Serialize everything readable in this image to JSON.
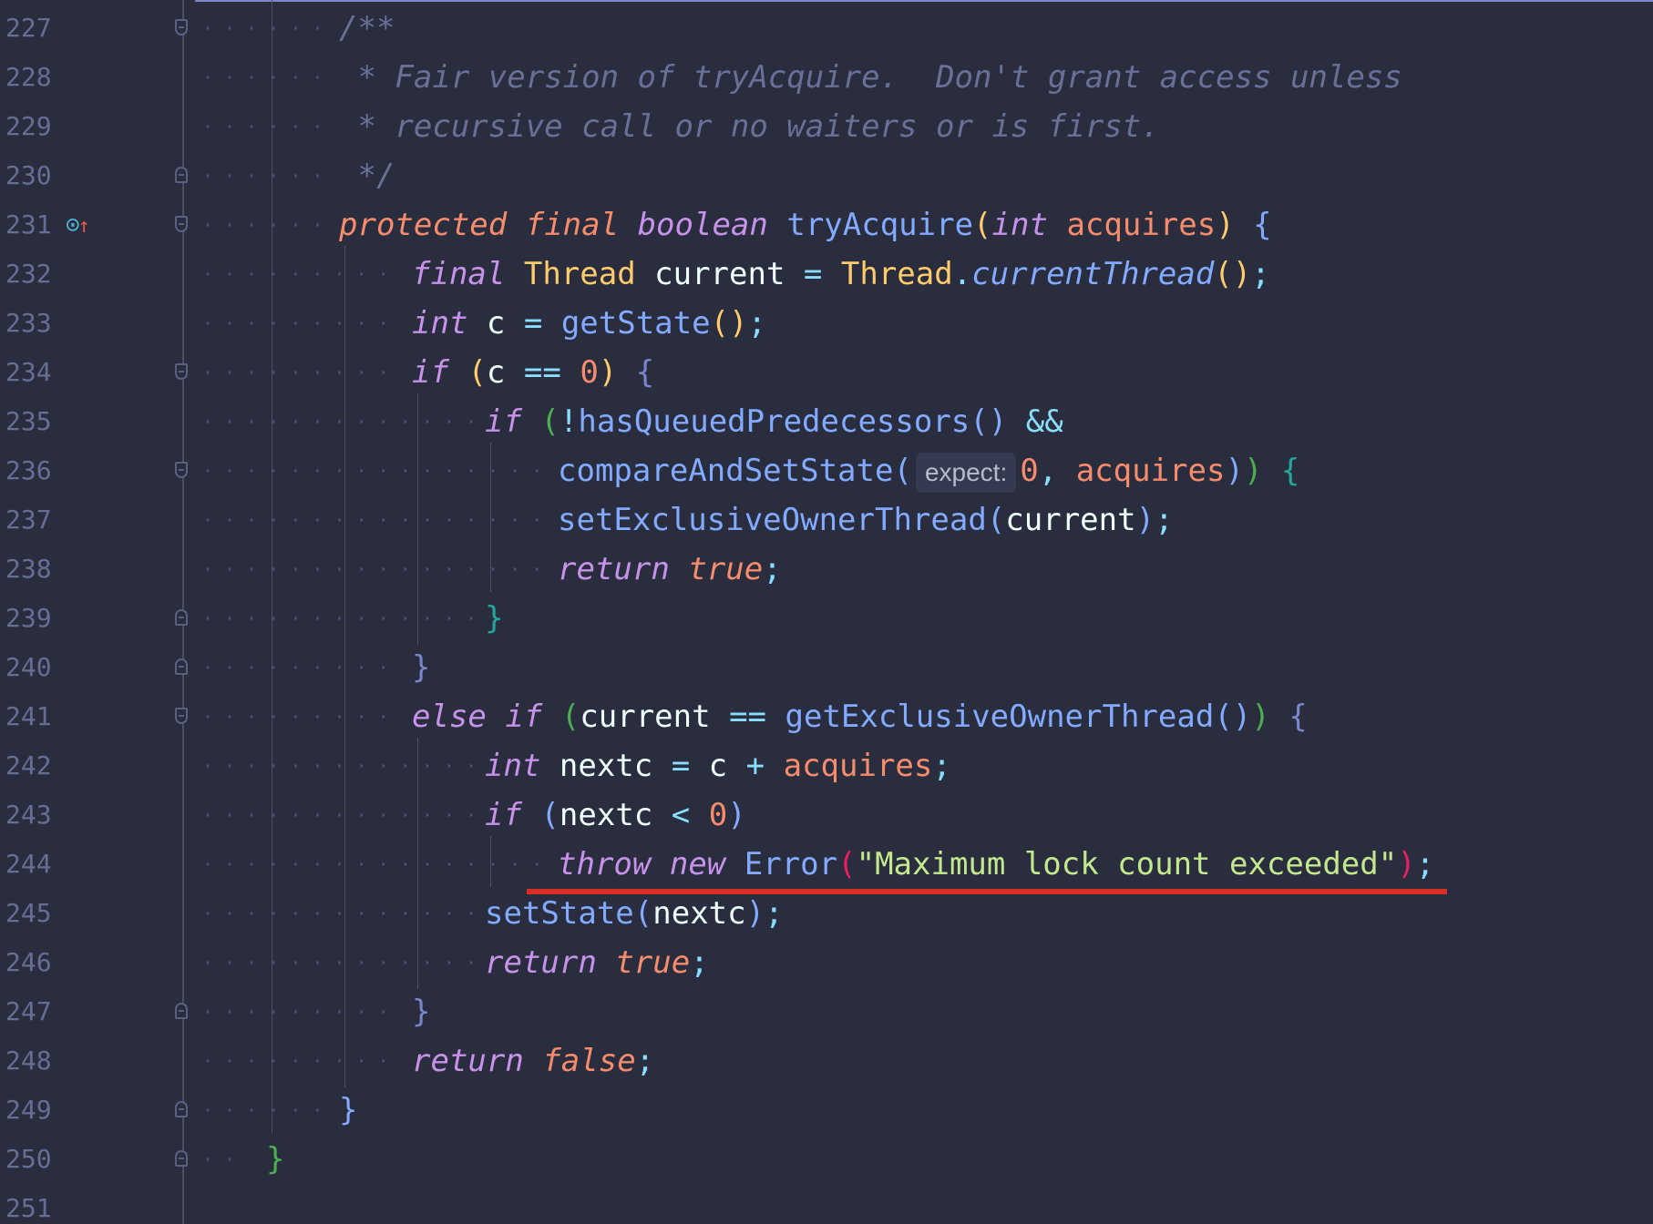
{
  "editor": {
    "lines": [
      {
        "n": "227",
        "indent": 0,
        "tokens": [
          [
            "cm",
            "/**"
          ]
        ]
      },
      {
        "n": "228",
        "indent": 0,
        "tokens": [
          [
            "cm",
            " * Fair version of tryAcquire.  Don't grant access unless"
          ]
        ]
      },
      {
        "n": "229",
        "indent": 0,
        "tokens": [
          [
            "cm",
            " * recursive call or no waiters or is first."
          ]
        ]
      },
      {
        "n": "230",
        "indent": 0,
        "tokens": [
          [
            "cm",
            " */"
          ]
        ]
      },
      {
        "n": "231",
        "indent": 0,
        "tokens": [
          [
            "mod",
            "protected"
          ],
          [
            "var",
            " "
          ],
          [
            "mod",
            "final"
          ],
          [
            "var",
            " "
          ],
          [
            "kw",
            "boolean"
          ],
          [
            "var",
            " "
          ],
          [
            "fn",
            "tryAcquire"
          ],
          [
            "b1",
            "("
          ],
          [
            "kw",
            "int"
          ],
          [
            "var",
            " "
          ],
          [
            "prm",
            "acquires"
          ],
          [
            "b1",
            ")"
          ],
          [
            "var",
            " "
          ],
          [
            "b2",
            "{"
          ]
        ]
      },
      {
        "n": "232",
        "indent": 1,
        "tokens": [
          [
            "kw",
            "final"
          ],
          [
            "var",
            " "
          ],
          [
            "typ",
            "Thread"
          ],
          [
            "var",
            " current "
          ],
          [
            "op",
            "="
          ],
          [
            "var",
            " "
          ],
          [
            "typ",
            "Thread"
          ],
          [
            "op",
            "."
          ],
          [
            "fni",
            "currentThread"
          ],
          [
            "b1",
            "()"
          ],
          [
            "op",
            ";"
          ]
        ]
      },
      {
        "n": "233",
        "indent": 1,
        "tokens": [
          [
            "kw",
            "int"
          ],
          [
            "var",
            " c "
          ],
          [
            "op",
            "="
          ],
          [
            "var",
            " "
          ],
          [
            "fn",
            "getState"
          ],
          [
            "b1",
            "()"
          ],
          [
            "op",
            ";"
          ]
        ]
      },
      {
        "n": "234",
        "indent": 1,
        "tokens": [
          [
            "kw",
            "if"
          ],
          [
            "var",
            " "
          ],
          [
            "b1",
            "("
          ],
          [
            "var",
            "c "
          ],
          [
            "op",
            "=="
          ],
          [
            "var",
            " "
          ],
          [
            "num",
            "0"
          ],
          [
            "b1",
            ")"
          ],
          [
            "var",
            " "
          ],
          [
            "b3",
            "{"
          ]
        ]
      },
      {
        "n": "235",
        "indent": 2,
        "tokens": [
          [
            "kw",
            "if"
          ],
          [
            "var",
            " "
          ],
          [
            "b4",
            "("
          ],
          [
            "op",
            "!"
          ],
          [
            "fn",
            "hasQueuedPredecessors"
          ],
          [
            "b2",
            "()"
          ],
          [
            "var",
            " "
          ],
          [
            "op",
            "&&"
          ]
        ]
      },
      {
        "n": "236",
        "indent": 3,
        "tokens": [
          [
            "fn",
            "compareAndSetState"
          ],
          [
            "b2",
            "("
          ],
          [
            "hint",
            "expect:"
          ],
          [
            "num",
            "0"
          ],
          [
            "op",
            ","
          ],
          [
            "var",
            " "
          ],
          [
            "prm",
            "acquires"
          ],
          [
            "b2",
            ")"
          ],
          [
            "b4",
            ")"
          ],
          [
            "var",
            " "
          ],
          [
            "b5",
            "{"
          ]
        ]
      },
      {
        "n": "237",
        "indent": 3,
        "tokens": [
          [
            "fn",
            "setExclusiveOwnerThread"
          ],
          [
            "b2",
            "("
          ],
          [
            "var",
            "current"
          ],
          [
            "b2",
            ")"
          ],
          [
            "op",
            ";"
          ]
        ]
      },
      {
        "n": "238",
        "indent": 3,
        "tokens": [
          [
            "kw",
            "return"
          ],
          [
            "var",
            " "
          ],
          [
            "bool",
            "true"
          ],
          [
            "op",
            ";"
          ]
        ]
      },
      {
        "n": "239",
        "indent": 2,
        "tokens": [
          [
            "b5",
            "}"
          ]
        ]
      },
      {
        "n": "240",
        "indent": 1,
        "tokens": [
          [
            "b3",
            "}"
          ]
        ]
      },
      {
        "n": "241",
        "indent": 1,
        "tokens": [
          [
            "kw",
            "else"
          ],
          [
            "var",
            " "
          ],
          [
            "kw",
            "if"
          ],
          [
            "var",
            " "
          ],
          [
            "b4",
            "("
          ],
          [
            "var",
            "current "
          ],
          [
            "op",
            "=="
          ],
          [
            "var",
            " "
          ],
          [
            "fn",
            "getExclusiveOwnerThread"
          ],
          [
            "b2",
            "()"
          ],
          [
            "b4",
            ")"
          ],
          [
            "var",
            " "
          ],
          [
            "b3",
            "{"
          ]
        ]
      },
      {
        "n": "242",
        "indent": 2,
        "tokens": [
          [
            "kw",
            "int"
          ],
          [
            "var",
            " nextc "
          ],
          [
            "op",
            "="
          ],
          [
            "var",
            " c "
          ],
          [
            "op",
            "+"
          ],
          [
            "var",
            " "
          ],
          [
            "prm",
            "acquires"
          ],
          [
            "op",
            ";"
          ]
        ]
      },
      {
        "n": "243",
        "indent": 2,
        "tokens": [
          [
            "kw",
            "if"
          ],
          [
            "var",
            " "
          ],
          [
            "b2",
            "("
          ],
          [
            "var",
            "nextc "
          ],
          [
            "op",
            "<"
          ],
          [
            "var",
            " "
          ],
          [
            "num",
            "0"
          ],
          [
            "b2",
            ")"
          ]
        ]
      },
      {
        "n": "244",
        "indent": 3,
        "tokens": [
          [
            "kw",
            "throw"
          ],
          [
            "var",
            " "
          ],
          [
            "kw",
            "new"
          ],
          [
            "var",
            " "
          ],
          [
            "cls",
            "Error"
          ],
          [
            "b6",
            "("
          ],
          [
            "str",
            "\"Maximum lock count exceeded\""
          ],
          [
            "b6",
            ")"
          ],
          [
            "op",
            ";"
          ]
        ]
      },
      {
        "n": "245",
        "indent": 2,
        "tokens": [
          [
            "fn",
            "setState"
          ],
          [
            "b2",
            "("
          ],
          [
            "var",
            "nextc"
          ],
          [
            "b2",
            ")"
          ],
          [
            "op",
            ";"
          ]
        ]
      },
      {
        "n": "246",
        "indent": 2,
        "tokens": [
          [
            "kw",
            "return"
          ],
          [
            "var",
            " "
          ],
          [
            "bool",
            "true"
          ],
          [
            "op",
            ";"
          ]
        ]
      },
      {
        "n": "247",
        "indent": 1,
        "tokens": [
          [
            "b3",
            "}"
          ]
        ]
      },
      {
        "n": "248",
        "indent": 1,
        "tokens": [
          [
            "kw",
            "return"
          ],
          [
            "var",
            " "
          ],
          [
            "bool",
            "false"
          ],
          [
            "op",
            ";"
          ]
        ]
      },
      {
        "n": "249",
        "indent": 0,
        "tokens": [
          [
            "b2",
            "}"
          ]
        ]
      },
      {
        "n": "250",
        "indent": -1,
        "tokens": [
          [
            "b4",
            "}"
          ]
        ]
      },
      {
        "n": "251",
        "indent": -1,
        "tokens": []
      }
    ],
    "gutter_icon": "implements-method-icon",
    "error_line": "244"
  }
}
